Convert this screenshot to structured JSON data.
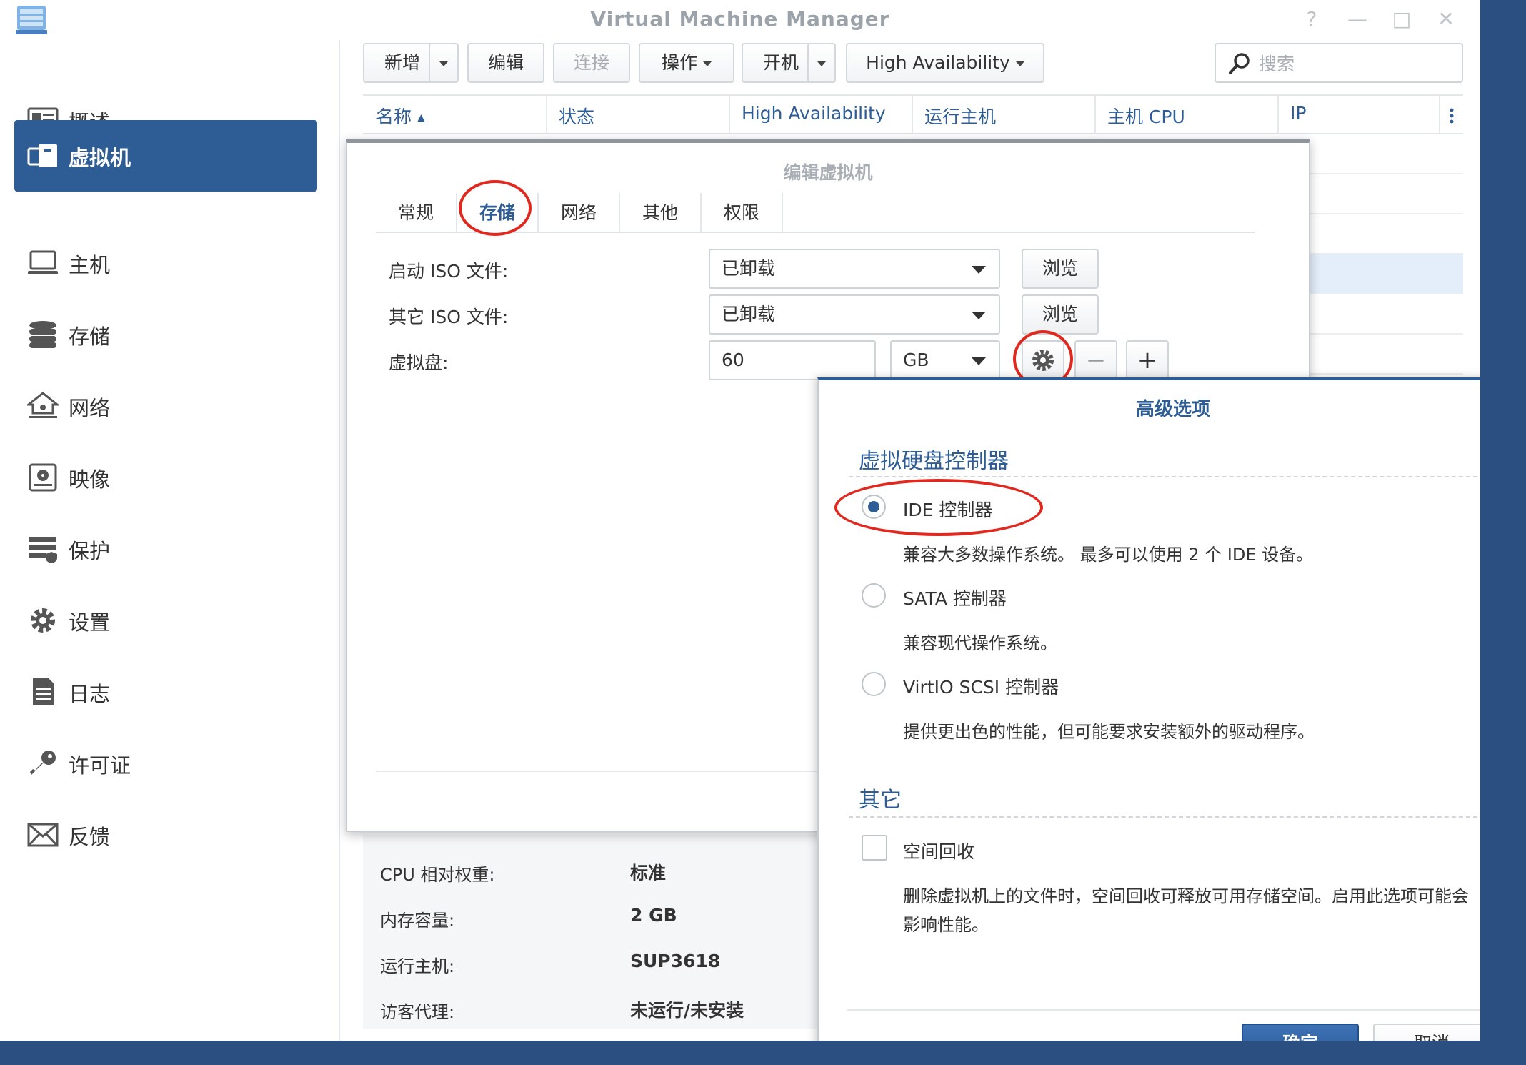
{
  "window": {
    "title": "Virtual Machine Manager",
    "controls": [
      "?",
      "—",
      "□",
      "✕"
    ]
  },
  "sidebar": {
    "items": [
      {
        "label": "概述",
        "icon": "overview-icon"
      },
      {
        "label": "虚拟机",
        "icon": "virtual-machine-icon",
        "active": true
      },
      {
        "label": "主机",
        "icon": "host-icon"
      },
      {
        "label": "存储",
        "icon": "storage-icon"
      },
      {
        "label": "网络",
        "icon": "network-icon"
      },
      {
        "label": "映像",
        "icon": "image-icon"
      },
      {
        "label": "保护",
        "icon": "protection-icon"
      },
      {
        "label": "设置",
        "icon": "settings-icon"
      },
      {
        "label": "日志",
        "icon": "log-icon"
      },
      {
        "label": "许可证",
        "icon": "license-icon"
      },
      {
        "label": "反馈",
        "icon": "feedback-icon"
      }
    ]
  },
  "toolbar": {
    "add": "新增",
    "edit": "编辑",
    "connect": "连接",
    "action": "操作",
    "power_on": "开机",
    "high_availability": "High Availability",
    "search_placeholder": "搜索"
  },
  "table": {
    "columns": [
      "名称",
      "状态",
      "High Availability",
      "运行主机",
      "主机 CPU",
      "IP"
    ],
    "sort_indicator": "▲"
  },
  "edit_dialog": {
    "title": "编辑虚拟机",
    "tabs": [
      "常规",
      "存储",
      "网络",
      "其他",
      "权限"
    ],
    "active_tab": "存储",
    "boot_iso_label": "启动 ISO 文件:",
    "boot_iso_value": "已卸载",
    "other_iso_label": "其它 ISO 文件:",
    "other_iso_value": "已卸载",
    "browse": "浏览",
    "vdisk_label": "虚拟盘:",
    "vdisk_size": "60",
    "vdisk_unit": "GB"
  },
  "summary": {
    "rows": [
      {
        "key": "CPU 相对权重:",
        "value": "标准"
      },
      {
        "key": "内存容量:",
        "value": "2 GB"
      },
      {
        "key": "运行主机:",
        "value": "SUP3618"
      },
      {
        "key": "访客代理:",
        "value": "未运行/未安装"
      }
    ]
  },
  "advanced_dialog": {
    "title": "高级选项",
    "controller_section": "虚拟硬盘控制器",
    "options": [
      {
        "label": "IDE 控制器",
        "desc": "兼容大多数操作系统。 最多可以使用 2 个 IDE 设备。",
        "selected": true
      },
      {
        "label": "SATA 控制器",
        "desc": "兼容现代操作系统。",
        "selected": false
      },
      {
        "label": "VirtIO SCSI 控制器",
        "desc": "提供更出色的性能，但可能要求安装额外的驱动程序。",
        "selected": false
      }
    ],
    "other_section": "其它",
    "space_reclaim_label": "空间回收",
    "space_reclaim_desc_line1": "删除虚拟机上的文件时，空间回收可释放可用存储空间。启用此选项可能会",
    "space_reclaim_desc_line2": "影响性能。",
    "ok": "确定",
    "cancel": "取消"
  },
  "colors": {
    "accent": "#2e5c94",
    "annotation": "#e1281f",
    "desktop": "#2a4f80"
  }
}
